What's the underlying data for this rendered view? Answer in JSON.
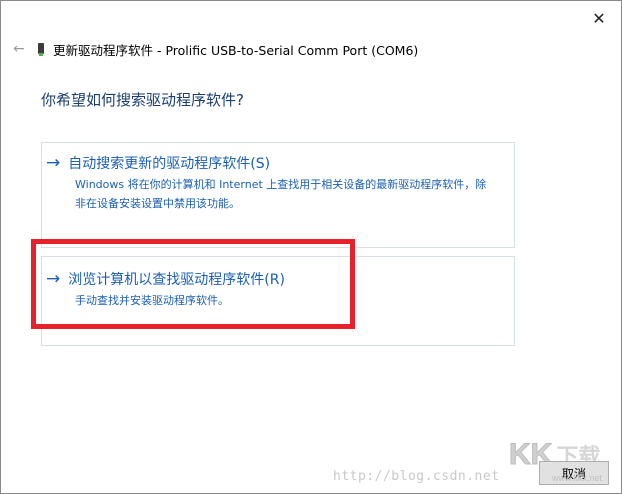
{
  "window": {
    "close_label": "✕",
    "back_label": "←",
    "title": "更新驱动程序软件 - Prolific USB-to-Serial Comm Port (COM6)"
  },
  "prompt": {
    "question": "你希望如何搜索驱动程序软件?"
  },
  "options": [
    {
      "arrow": "→",
      "title": "自动搜索更新的驱动程序软件(S)",
      "description": "Windows 将在你的计算机和 Internet 上查找用于相关设备的最新驱动程序软件，除非在设备安装设置中禁用该功能。"
    },
    {
      "arrow": "→",
      "title": "浏览计算机以查找驱动程序软件(R)",
      "description": "手动查找并安装驱动程序软件。"
    }
  ],
  "footer": {
    "cancel_label": "取消"
  },
  "watermark": {
    "url": "http://blog.csdn.net",
    "logo_letters": "KK",
    "logo_char": "下载",
    "logo_sub": "www.kkx.net"
  },
  "colors": {
    "link_blue": "#1a5fb4",
    "heading_blue": "#1a3e6e",
    "highlight_red": "#e8202a"
  },
  "icons": {
    "back": "back-arrow-icon",
    "device": "usb-device-icon",
    "close": "close-icon",
    "option_arrow": "right-arrow-icon"
  }
}
